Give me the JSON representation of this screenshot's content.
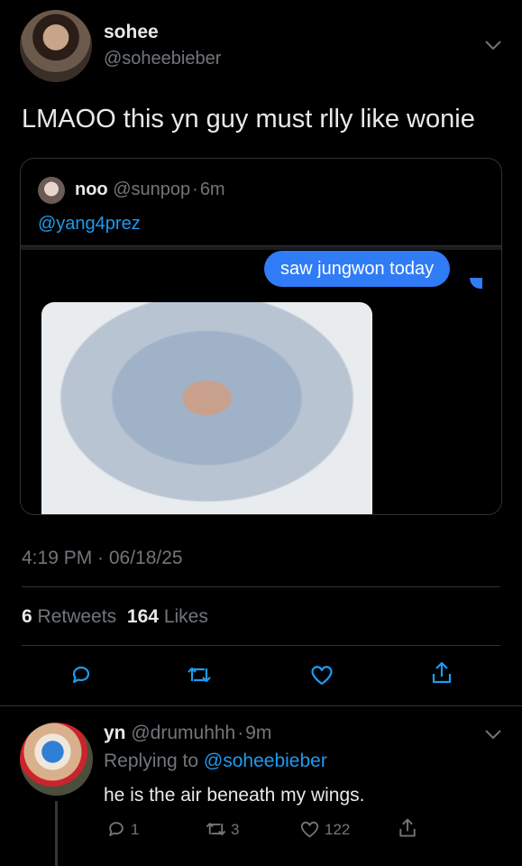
{
  "main_tweet": {
    "display_name": "sohee",
    "handle": "@soheebieber",
    "text": "LMAOO this yn guy must rlly like wonie",
    "timestamp": "4:19 PM · 06/18/25",
    "retweets_count": "6",
    "retweets_label": "Retweets",
    "likes_count": "164",
    "likes_label": "Likes"
  },
  "quoted_tweet": {
    "display_name": "noo",
    "handle": "@sunpop",
    "separator": "·",
    "age": "6m",
    "mention": "@yang4prez",
    "bubble_text": "saw jungwon today"
  },
  "reply": {
    "display_name": "yn",
    "handle": "@drumuhhh",
    "separator": "·",
    "age": "9m",
    "replying_label": "Replying to",
    "replying_handle": "@soheebieber",
    "text": "he is the air beneath my wings.",
    "reply_count": "1",
    "retweet_count": "3",
    "like_count": "122"
  },
  "icons": [
    "chevron-down-icon",
    "reply-icon",
    "retweet-icon",
    "heart-icon",
    "share-icon"
  ],
  "colors": {
    "accent": "#1d9bf0",
    "bubble": "#2f7cf6",
    "muted": "#71767b",
    "background": "#000000"
  }
}
